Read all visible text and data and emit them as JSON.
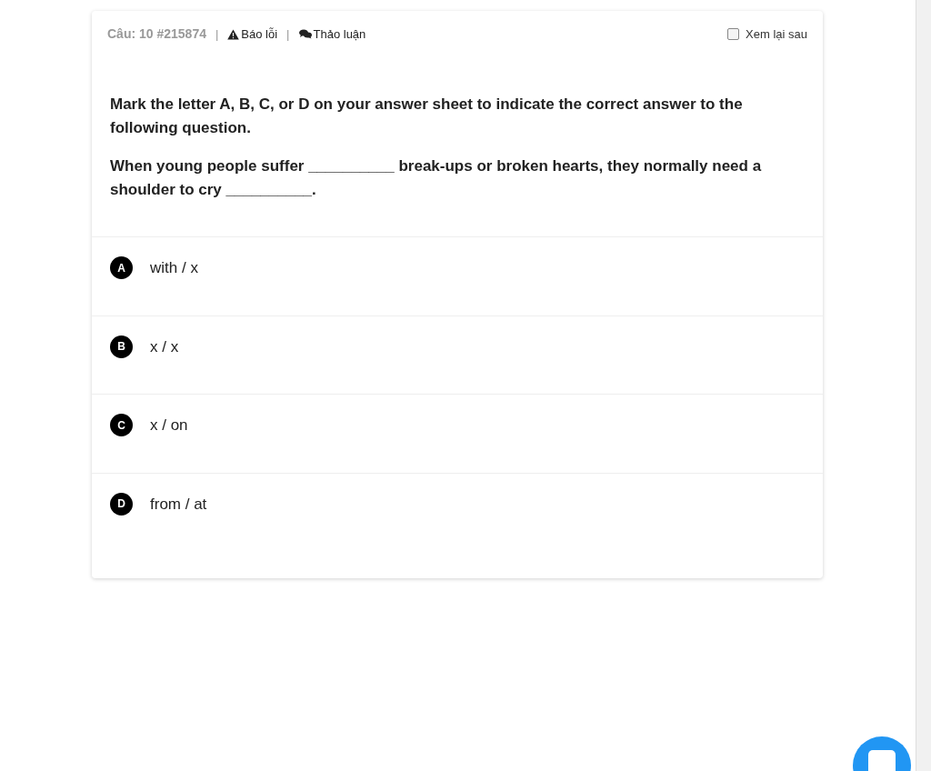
{
  "header": {
    "question_number": "Câu: 10 #215874",
    "separator_1": "|",
    "report_link": "Báo lỗi",
    "separator_2": "|",
    "discuss_link": "Thảo luận",
    "review_later": {
      "label": "Xem lại sau",
      "checked": false
    }
  },
  "question": {
    "instruction": "Mark the letter A, B, C, or D on your answer sheet to indicate the correct answer to the following question.",
    "text": "When young people suffer __________ break-ups or broken hearts, they normally need a shoulder to cry __________."
  },
  "options": [
    {
      "letter": "A",
      "text": "with / x"
    },
    {
      "letter": "B",
      "text": "x / x"
    },
    {
      "letter": "C",
      "text": "x / on"
    },
    {
      "letter": "D",
      "text": "from / at"
    }
  ]
}
